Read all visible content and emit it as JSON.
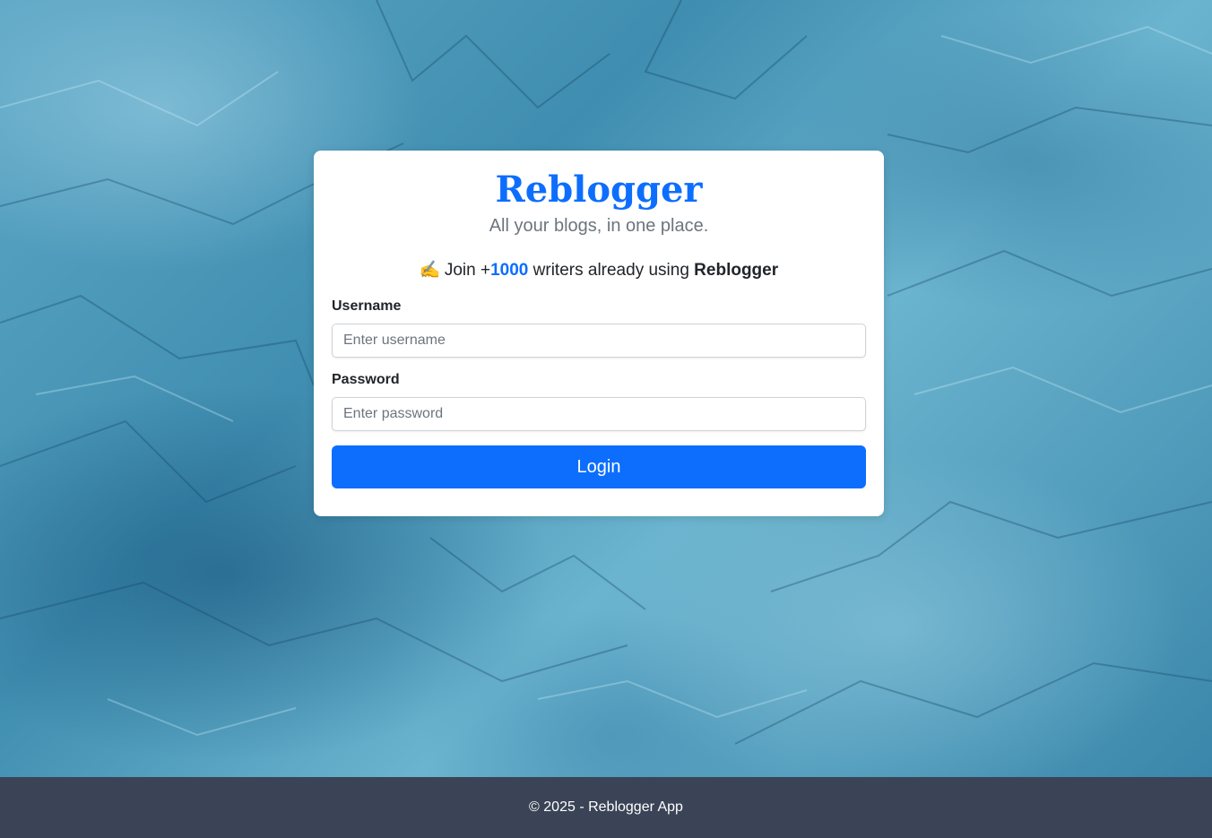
{
  "app": {
    "brand": "Reblogger",
    "tagline": "All your blogs, in one place."
  },
  "promo": {
    "emoji": "✍️",
    "prefix": "Join +",
    "count": "1000",
    "middle": " writers already using ",
    "app_name": "Reblogger"
  },
  "form": {
    "username_label": "Username",
    "username_placeholder": "Enter username",
    "username_value": "",
    "password_label": "Password",
    "password_placeholder": "Enter password",
    "password_value": "",
    "login_label": "Login"
  },
  "footer": {
    "text": "© 2025 - Reblogger App"
  },
  "colors": {
    "accent": "#0d6efd",
    "footer_bg": "#3b4456"
  }
}
